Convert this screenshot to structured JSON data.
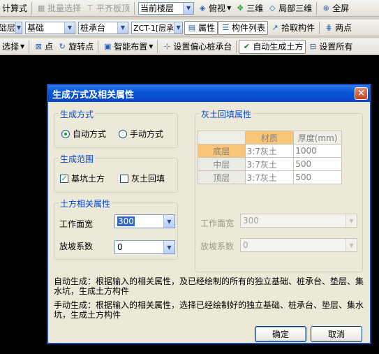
{
  "toolbar1": {
    "items": [
      "计算式",
      "批量选择",
      "平齐板顶",
      "当前楼层",
      "俯视",
      "三维",
      "局部三维",
      "全屏"
    ]
  },
  "toolbar2": {
    "floor": "基础层",
    "category": "基础",
    "type": "桩承台",
    "element": "ZCT-1[层承",
    "attr_btn": "属性",
    "list_btn": "构件列表",
    "pick_btn": "拾取构件",
    "two_point": "两点"
  },
  "toolbar3": {
    "items": [
      "选择",
      "点",
      "旋转点",
      "智能布置",
      "设置偏心桩承台",
      "自动生成土方",
      "设置所有"
    ]
  },
  "dialog": {
    "title": "生成方式及相关属性",
    "close": "×",
    "mode": {
      "label": "生成方式",
      "auto": "自动方式",
      "manual": "手动方式"
    },
    "scope": {
      "label": "生成范围",
      "pit": "基坑土方",
      "backfill": "灰土回填"
    },
    "earth": {
      "label": "土方相关属性",
      "width_label": "工作面宽",
      "width_value": "300",
      "slope_label": "放坡系数",
      "slope_value": "0"
    },
    "backfill_props": {
      "label": "灰土回填属性",
      "col_material": "材质",
      "col_thickness": "厚度(mm)",
      "rows": [
        {
          "layer": "底层",
          "material": "3:7灰土",
          "thickness": "1000"
        },
        {
          "layer": "中层",
          "material": "3:7灰土",
          "thickness": "500"
        },
        {
          "layer": "顶层",
          "material": "3:7灰土",
          "thickness": "500"
        }
      ],
      "width_label": "工作面宽",
      "width_value": "300",
      "slope_label": "放坡系数",
      "slope_value": "0"
    },
    "desc_auto": "自动生成：根据输入的相关属性，及已经绘制的所有的独立基础、桩承台、垫层、集水坑，生成土方构件",
    "desc_manual": "手动生成：根据输入的相关属性，选择已经绘制好的独立基础、桩承台、垫层、集水坑，生成土方构件",
    "ok": "确定",
    "cancel": "取消"
  }
}
